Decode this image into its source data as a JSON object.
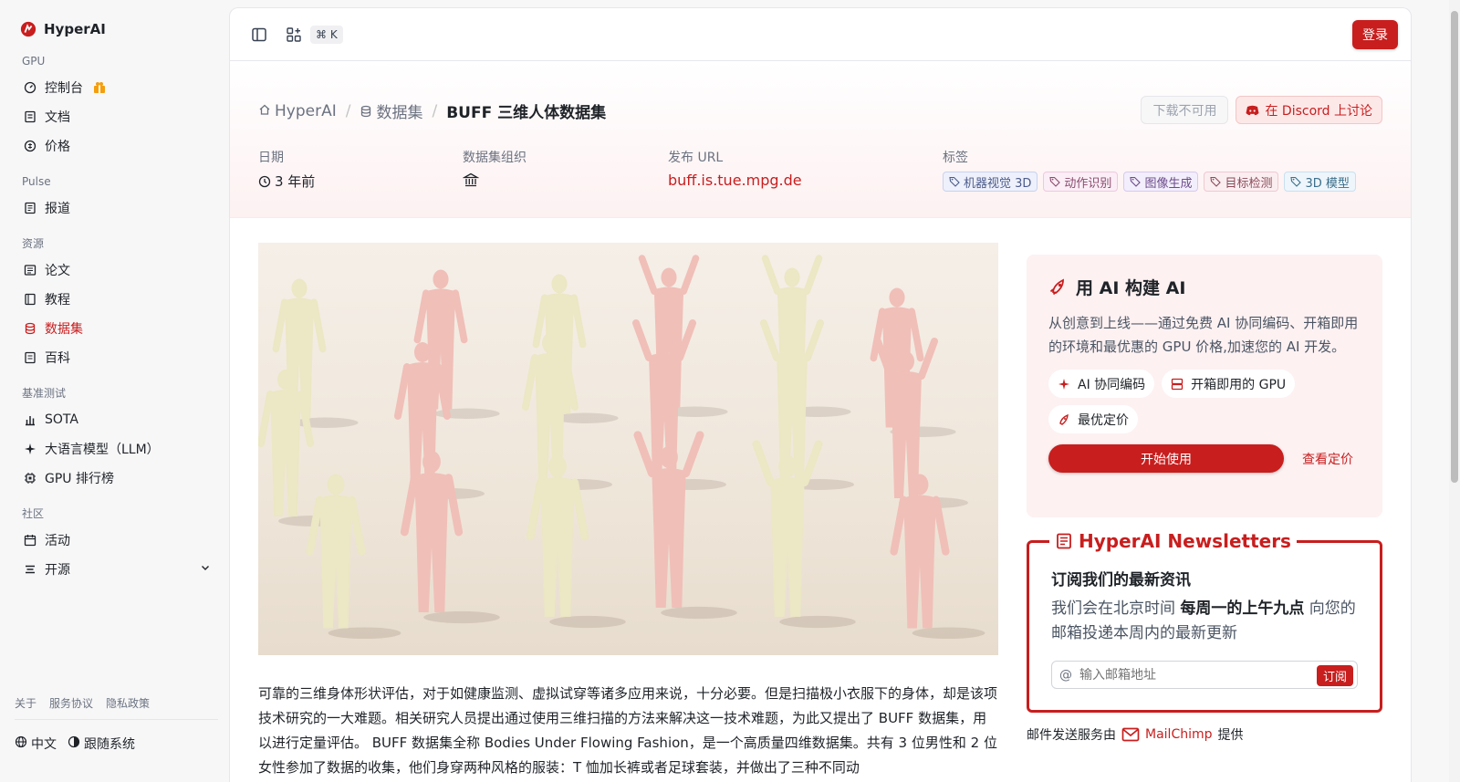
{
  "brand": {
    "name": "HyperAI"
  },
  "sidebar": {
    "sections": [
      {
        "label": "GPU",
        "items": [
          {
            "label": "控制台",
            "icon": "dashboard-icon"
          },
          {
            "label": "文档",
            "icon": "doc-icon"
          },
          {
            "label": "价格",
            "icon": "price-icon"
          }
        ]
      },
      {
        "label": "Pulse",
        "items": [
          {
            "label": "报道",
            "icon": "news-icon"
          }
        ]
      },
      {
        "label": "资源",
        "items": [
          {
            "label": "论文",
            "icon": "paper-icon"
          },
          {
            "label": "教程",
            "icon": "tutorial-icon"
          },
          {
            "label": "数据集",
            "icon": "database-icon",
            "active": true
          },
          {
            "label": "百科",
            "icon": "wiki-icon"
          }
        ]
      },
      {
        "label": "基准测试",
        "items": [
          {
            "label": "SOTA",
            "icon": "chart-icon"
          },
          {
            "label": "大语言模型（LLM）",
            "icon": "sparkle-icon"
          },
          {
            "label": "GPU 排行榜",
            "icon": "chip-icon"
          }
        ]
      },
      {
        "label": "社区",
        "items": [
          {
            "label": "活动",
            "icon": "calendar-icon"
          },
          {
            "label": "开源",
            "icon": "list-icon"
          }
        ]
      }
    ],
    "footer_links": [
      "关于",
      "服务协议",
      "隐私政策"
    ],
    "language": "中文",
    "theme": "跟随系统"
  },
  "topbar": {
    "shortcut": "⌘ K",
    "login": "登录"
  },
  "breadcrumb": {
    "home": "HyperAI",
    "datasets": "数据集",
    "current": "BUFF 三维人体数据集"
  },
  "actions": {
    "download": "下载不可用",
    "discord": "在 Discord 上讨论"
  },
  "meta": {
    "date_label": "日期",
    "date_value": "3 年前",
    "org_label": "数据集组织",
    "url_label": "发布 URL",
    "url_value": "buff.is.tue.mpg.de",
    "tags_label": "标签",
    "tags": [
      {
        "label": "机器视觉 3D",
        "color": "#4b5a8a",
        "bg": "#eef1fb",
        "border": "#c9d2f0"
      },
      {
        "label": "动作识别",
        "color": "#8a4b6e",
        "bg": "#fbeef6",
        "border": "#efc9de"
      },
      {
        "label": "图像生成",
        "color": "#6b4b8a",
        "bg": "#f3eefb",
        "border": "#d8c9ef"
      },
      {
        "label": "目标检测",
        "color": "#8a4b5a",
        "bg": "#fbeef1",
        "border": "#efc9d2"
      },
      {
        "label": "3D 模型",
        "color": "#3b6e8a",
        "bg": "#eef6fb",
        "border": "#c9e0ef"
      }
    ]
  },
  "description": "可靠的三维身体形状评估，对于如健康监测、虚拟试穿等诸多应用来说，十分必要。但是扫描极小衣服下的身体，却是该项技术研究的一大难题。相关研究人员提出通过使用三维扫描的方法来解决这一技术难题，为此又提出了 BUFF 数据集，用以进行定量评估。 BUFF 数据集全称 Bodies Under Flowing Fashion，是一个高质量四维数据集。共有 3 位男性和 2 位女性参加了数据的收集，他们身穿两种风格的服装：T 恤加长裤或者足球套装，并做出了三种不同动",
  "promo": {
    "title": "用 AI 构建 AI",
    "text": "从创意到上线——通过免费 AI 协同编码、开箱即用的环境和最优惠的 GPU 价格,加速您的 AI 开发。",
    "chips": [
      "AI 协同编码",
      "开箱即用的 GPU",
      "最优定价"
    ],
    "start": "开始使用",
    "pricing": "查看定价"
  },
  "newsletter": {
    "title": "HyperAI Newsletters",
    "heading": "订阅我们的最新资讯",
    "text_pre": "我们会在北京时间 ",
    "text_bold": "每周一的上午九点",
    "text_post": " 向您的邮箱投递本周内的最新更新",
    "placeholder": "输入邮箱地址",
    "subscribe": "订阅",
    "provider_pre": "邮件发送服务由",
    "provider": "MailChimp",
    "provider_post": "提供"
  },
  "colors": {
    "accent": "#c81e1e"
  }
}
